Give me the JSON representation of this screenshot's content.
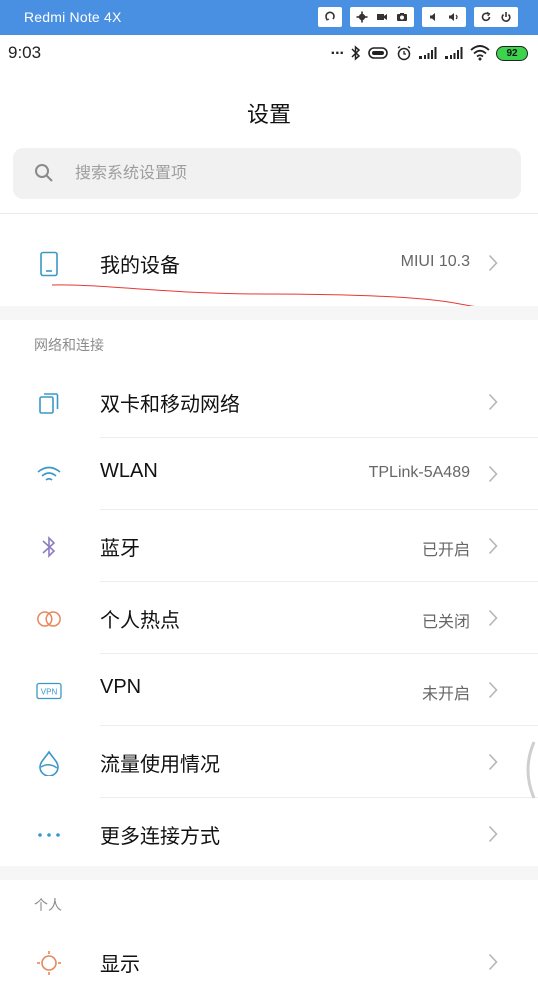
{
  "emulator": {
    "title": "Redmi Note 4X"
  },
  "status": {
    "time": "9:03",
    "battery": "92",
    "more_dots": "..."
  },
  "header": {
    "title": "设置"
  },
  "search": {
    "placeholder": "搜索系统设置项"
  },
  "device": {
    "label": "我的设备",
    "value": "MIUI 10.3"
  },
  "sections": [
    {
      "title": "网络和连接",
      "items": [
        {
          "label": "双卡和移动网络",
          "value": "",
          "icon": "sim-cards-icon"
        },
        {
          "label": "WLAN",
          "value": "TPLink-5A489",
          "icon": "wifi-icon"
        },
        {
          "label": "蓝牙",
          "value": "已开启",
          "icon": "bluetooth-icon"
        },
        {
          "label": "个人热点",
          "value": "已关闭",
          "icon": "hotspot-icon"
        },
        {
          "label": "VPN",
          "value": "未开启",
          "icon": "vpn-icon"
        },
        {
          "label": "流量使用情况",
          "value": "",
          "icon": "data-usage-icon"
        },
        {
          "label": "更多连接方式",
          "value": "",
          "icon": "more-connections-icon"
        }
      ]
    },
    {
      "title": "个人",
      "items": [
        {
          "label": "显示",
          "value": "",
          "icon": "display-brightness-icon"
        }
      ]
    }
  ],
  "colors": {
    "emulator_bar": "#4a90e2",
    "battery": "#3bd44c",
    "icon_blue": "#3b97c9"
  }
}
